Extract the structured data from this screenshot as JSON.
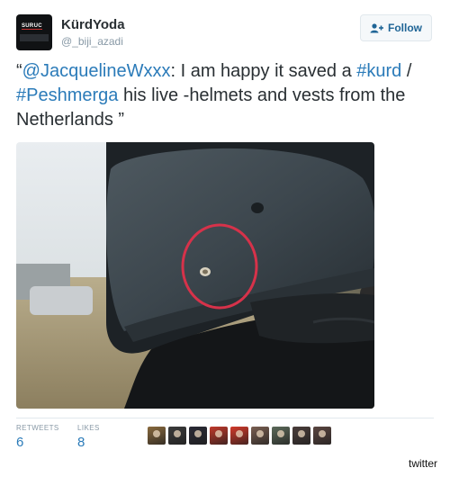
{
  "author": {
    "name": "KürdYoda",
    "handle": "@_biji_azadi",
    "avatar_text": "SURUC"
  },
  "follow": {
    "label": "Follow",
    "icon": "add-user-icon",
    "color": "#1f6596"
  },
  "tweet": {
    "open_quote": "“",
    "mention": "@JacquelineWxxx",
    "text_1": ": I am happy it saved a ",
    "hashtag_1": "#kurd",
    "sep": " / ",
    "hashtag_2": "#Peshmerga",
    "text_2": " his live -helmets and vests from the Netherlands ",
    "close_quote": "”",
    "link_color": "#2b7bb9"
  },
  "stats": {
    "retweets_label": "RETWEETS",
    "retweets_value": "6",
    "likes_label": "LIKES",
    "likes_value": "8"
  },
  "likers": [
    {
      "icon": "liker-avatar-1",
      "color": "#8a6a3e"
    },
    {
      "icon": "liker-avatar-2",
      "color": "#3b3b3b"
    },
    {
      "icon": "liker-avatar-3",
      "color": "#2a2a35"
    },
    {
      "icon": "liker-avatar-4",
      "color": "#c0392b"
    },
    {
      "icon": "liker-avatar-5",
      "color": "#d23a2a"
    },
    {
      "icon": "liker-avatar-6",
      "color": "#7a5f52"
    },
    {
      "icon": "liker-avatar-7",
      "color": "#5c6a5a"
    },
    {
      "icon": "liker-avatar-8",
      "color": "#4a3d3a"
    },
    {
      "icon": "liker-avatar-9",
      "color": "#5a4540"
    }
  ],
  "watermark": "twitter"
}
